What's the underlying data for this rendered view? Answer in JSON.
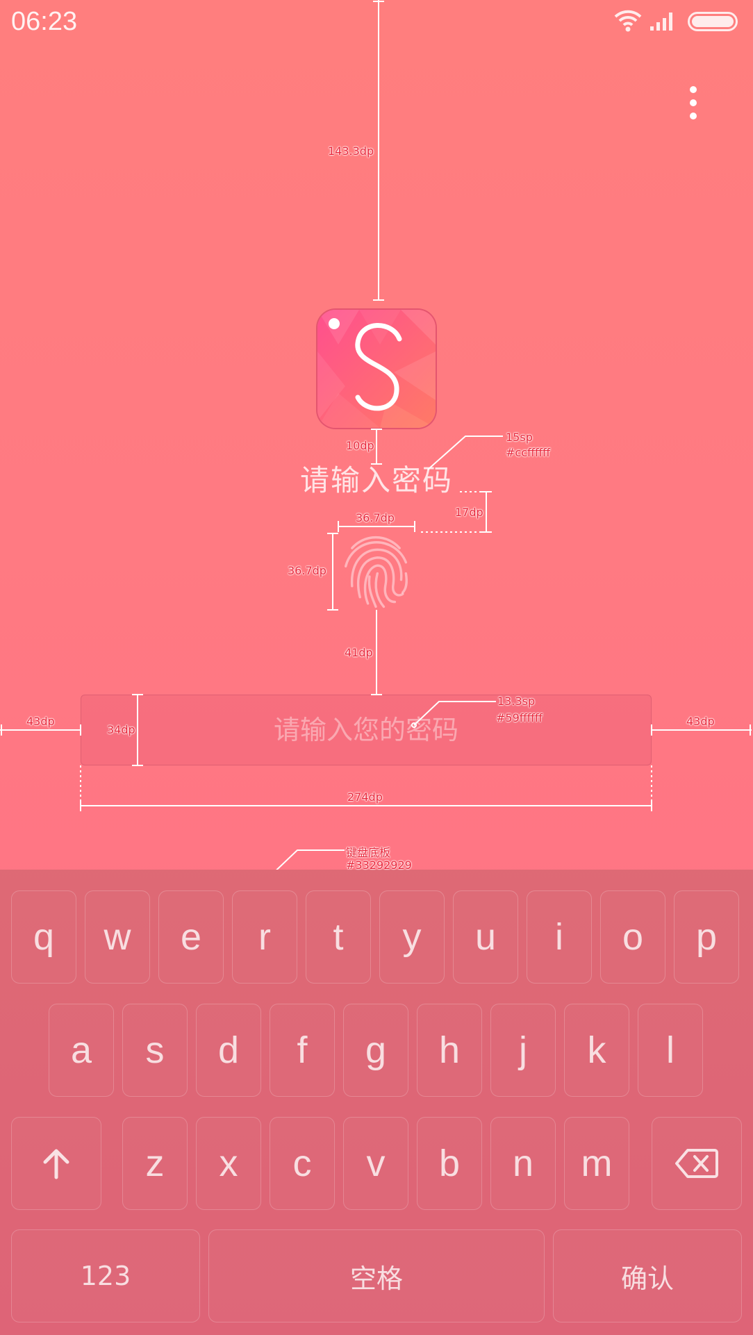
{
  "status_bar": {
    "time": "06:23",
    "icons": [
      "wifi-icon",
      "signal-icon",
      "battery-icon"
    ]
  },
  "header": {
    "menu_icon": "more-vertical-icon"
  },
  "app": {
    "icon": "selfiecity-s-logo"
  },
  "lock_screen": {
    "title": "请输入密码",
    "fingerprint_icon": "fingerprint-icon",
    "password_placeholder": "请输入您的密码",
    "password_value": ""
  },
  "spec_annotations": {
    "top_margin": "143.3dp",
    "icon_title_gap": "10dp",
    "title_font": "15sp",
    "title_color": "#ccffffff",
    "title_fp_gap": "17dp",
    "fp_width": "36.7dp",
    "fp_height": "36.7dp",
    "fp_input_gap": "41dp",
    "input_font": "13.3sp",
    "input_color": "#59ffffff",
    "side_margin_left": "43dp",
    "side_margin_right": "43dp",
    "input_height": "34dp",
    "input_width": "274dp",
    "keyboard_label": "键盘底板",
    "keyboard_color": "#33292929"
  },
  "keyboard": {
    "row1": [
      "q",
      "w",
      "e",
      "r",
      "t",
      "y",
      "u",
      "i",
      "o",
      "p"
    ],
    "row2": [
      "a",
      "s",
      "d",
      "f",
      "g",
      "h",
      "j",
      "k",
      "l"
    ],
    "row3": [
      "z",
      "x",
      "c",
      "v",
      "b",
      "n",
      "m"
    ],
    "shift_icon": "arrow-up-icon",
    "backspace_icon": "backspace-icon",
    "numbers_label": "123",
    "space_label": "空格",
    "confirm_label": "确认"
  },
  "colors": {
    "background_top": "#ff7e7e",
    "background_bottom": "#ff6f86",
    "title_text": "#ccffffff",
    "placeholder_text": "#59ffffff",
    "keyboard_panel": "#33292929",
    "annotation": "#e8283c"
  }
}
